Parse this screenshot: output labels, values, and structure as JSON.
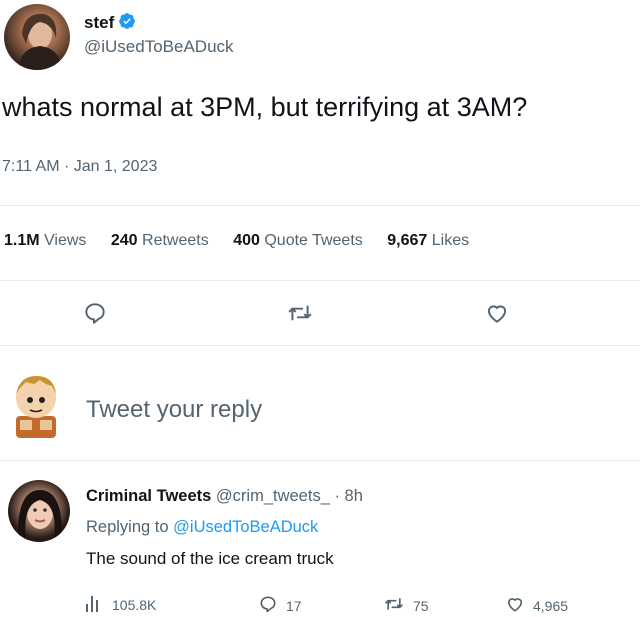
{
  "tweet": {
    "author_name": "stef",
    "author_handle": "@iUsedToBeADuck",
    "text": "whats normal at 3PM, but terrifying at 3AM?",
    "timestamp": "7:11 AM · Jan 1, 2023",
    "stats": [
      {
        "num": "1.1M",
        "label": "Views"
      },
      {
        "num": "240",
        "label": "Retweets"
      },
      {
        "num": "400",
        "label": "Quote Tweets"
      },
      {
        "num": "9,667",
        "label": "Likes"
      }
    ]
  },
  "composer": {
    "placeholder": "Tweet your reply"
  },
  "reply": {
    "author_name": "Criminal Tweets",
    "author_handle": "@crim_tweets_",
    "time": "· 8h",
    "replying_prefix": "Replying to",
    "replying_handle": "@iUsedToBeADuck",
    "text": "The sound of the ice cream truck",
    "metrics": {
      "views": "105.8K",
      "replies": "17",
      "retweets": "75",
      "likes": "4,965"
    }
  },
  "colors": {
    "accent": "#1d9bf0",
    "secondary_text": "#536471",
    "divider": "#e6ecf0"
  },
  "icons": [
    "verified-badge-icon",
    "reply-icon",
    "retweet-icon",
    "like-icon",
    "views-icon"
  ]
}
